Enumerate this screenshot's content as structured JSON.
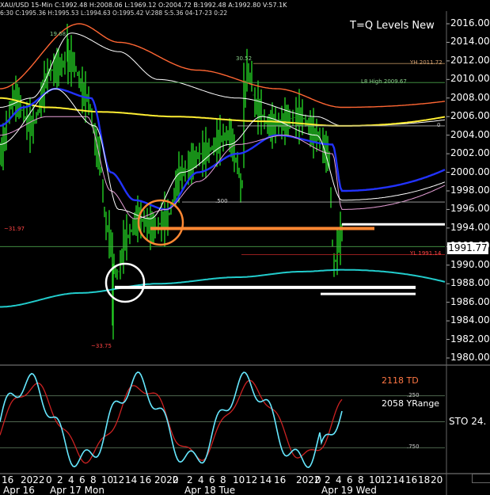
{
  "header": {
    "symbol_line": "XAU/USD  15-Min  C:1992.48  H:2008.06  L:1969.12  O:2004.72  B:1992.48  A:1992.80  V:57.1K",
    "detail_line": "6:30  C:1995.36  H:1995.53  L:1994.63  O:1995.42  V:288  S:5.36  04-17-23  0:22"
  },
  "chart_title": "T=Q Levels New",
  "last_price_label": "1991.77",
  "right_info": {
    "td": "2118 TD",
    "yrange": "2058 YRange"
  },
  "stochastic_label": "STO  24.",
  "colors": {
    "background": "#000000",
    "price": "#22cc22",
    "ema_white": "#ffffff",
    "ema_blue": "#2233ff",
    "ema_pink": "#e8a0d8",
    "ema_yellow": "#ffee33",
    "ema_orange": "#ff6633",
    "ema_cyan": "#22cccc",
    "sto_fast": "#66e8ff",
    "sto_slow": "#cc2222",
    "hline_orange": "#ff8833",
    "hline_white": "#ffffff"
  },
  "chart_data": {
    "type": "line",
    "title": "T=Q Levels New",
    "ylim": [
      1980,
      2016
    ],
    "yticks": [
      "2016.00",
      "2014.00",
      "2012.00",
      "2010.00",
      "2008.00",
      "2006.00",
      "2004.00",
      "2002.00",
      "2000.00",
      "1998.00",
      "1996.00",
      "1994.00",
      "1992.00",
      "1990.00",
      "1988.00",
      "1986.00",
      "1984.00",
      "1982.00",
      "1980.00"
    ],
    "x_tick_labels": [
      "16",
      "2022",
      "0",
      "2",
      "4",
      "6",
      "8",
      "10",
      "12",
      "14",
      "16",
      "2022",
      "0",
      "2",
      "4",
      "6",
      "8",
      "10",
      "12",
      "14",
      "16",
      "2022",
      "0",
      "2",
      "4",
      "6",
      "8",
      "10",
      "12",
      "14",
      "16",
      "18",
      "20"
    ],
    "x_date_labels": [
      "Apr 16",
      "Apr 17 Mon",
      "Apr 18 Tue",
      "Apr 19 Wed"
    ],
    "annotations": [
      {
        "text": "19.68",
        "price": 2014.8
      },
      {
        "text": "30.52",
        "price": 2012.2
      },
      {
        "text": "YH 2011.72",
        "price": 2011.72
      },
      {
        "text": "L8 High 2009.67",
        "price": 2009.67
      },
      {
        "text": "0",
        "price": 2005.0
      },
      {
        "text": ".500",
        "price": 1996.8
      },
      {
        "text": "~31.97",
        "price": 1993.8
      },
      {
        "text": "YL 1991.14",
        "price": 1991.14
      },
      {
        "text": "~33.75",
        "price": 1981.2
      }
    ],
    "levels": [
      {
        "name": "yh-line",
        "price": 2011.72,
        "color": "#b08a5a"
      },
      {
        "name": "l8-high-line",
        "price": 2009.67,
        "color": "#4aa04a"
      },
      {
        "name": "zero-line",
        "price": 2005.0,
        "color": "#aaaaaa"
      },
      {
        "name": "fib-500",
        "price": 1996.8,
        "color": "#aaaaaa"
      },
      {
        "name": "green-low-line",
        "price": 1992.0,
        "color": "#4aa04a"
      },
      {
        "name": "yl-line",
        "price": 1991.14,
        "color": "#aa2222"
      },
      {
        "name": "orange-thick",
        "price": 1993.95,
        "color": "#ff8833"
      },
      {
        "name": "white-level-1",
        "price": 1994.4,
        "color": "#ffffff"
      },
      {
        "name": "white-level-2",
        "price": 1987.6,
        "color": "#ffffff"
      },
      {
        "name": "white-level-3",
        "price": 1986.9,
        "color": "#ffffff"
      }
    ],
    "circles": [
      {
        "name": "orange-circle",
        "x_idx": 200,
        "price": 1995.1,
        "color": "#ff8833"
      },
      {
        "name": "white-circle",
        "x_idx": 158,
        "price": 1988.5,
        "color": "#ffffff"
      }
    ],
    "stochastic": {
      "ylim": [
        0,
        100
      ],
      "levels": [
        {
          "label": ".250",
          "value": 75
        },
        {
          "label": "",
          "value": 50
        },
        {
          "label": ".750",
          "value": 25
        }
      ]
    }
  }
}
